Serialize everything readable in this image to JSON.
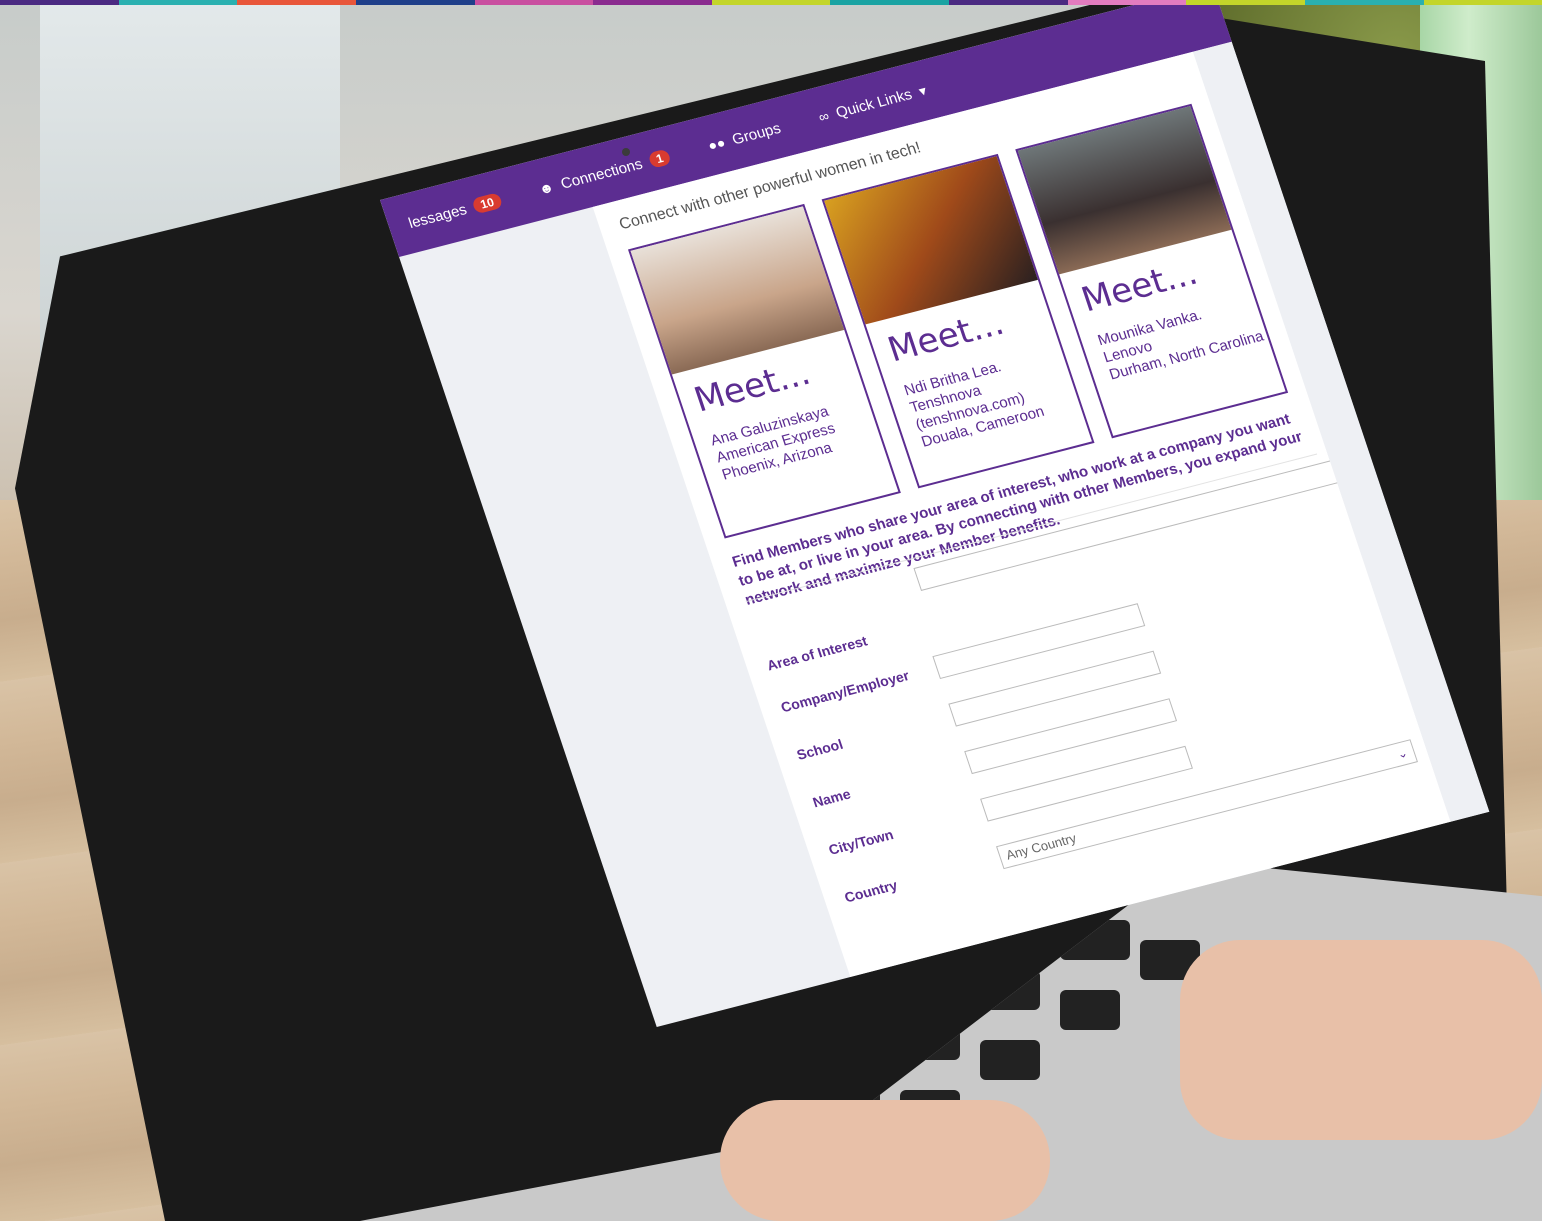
{
  "stripes": [
    "#4b2a82",
    "#4b2a82",
    "#2ab0b0",
    "#2ab0b0",
    "#e8563a",
    "#e8563a",
    "#1f3f8a",
    "#1f3f8a",
    "#c94fa0",
    "#c94fa0",
    "#8a2b8f",
    "#8a2b8f",
    "#c3d52a",
    "#c3d52a",
    "#1aa3a3",
    "#1aa3a3",
    "#4b2a82",
    "#4b2a82",
    "#e27cbf",
    "#e27cbf",
    "#c3d52a",
    "#c3d52a",
    "#2ab0b0",
    "#2ab0b0",
    "#c3d52a",
    "#c3d52a"
  ],
  "nav": {
    "messages_label": "lessages",
    "messages_count": "10",
    "connections_label": "Connections",
    "connections_count": "1",
    "groups_label": "Groups",
    "quicklinks_label": "Quick Links"
  },
  "tagline": "Connect with other powerful women in tech!",
  "cards": [
    {
      "meet": "Meet...",
      "name": "Ana Galuzinskaya",
      "company": "American Express",
      "location": "Phoenix, Arizona"
    },
    {
      "meet": "Meet...",
      "name": "Ndi Britha Lea.",
      "company": "Tenshnova (tenshnova.com)",
      "location": "Douala, Cameroon"
    },
    {
      "meet": "Meet...",
      "name": "Mounika Vanka.",
      "company": "Lenovo",
      "location": "Durham, North Carolina"
    }
  ],
  "intro": "Find Members who share your area of interest, who work at a company you want to be at, or live in your area. By connecting with other Members, you expand your network and maximize your Member benefits.",
  "form": {
    "area_label": "Area of Interest",
    "company_label": "Company/Employer",
    "school_label": "School",
    "name_label": "Name",
    "city_label": "City/Town",
    "country_label": "Country",
    "country_value": "Any Country"
  },
  "colors": {
    "brand": "#5c2d91",
    "badge": "#d93b30"
  }
}
